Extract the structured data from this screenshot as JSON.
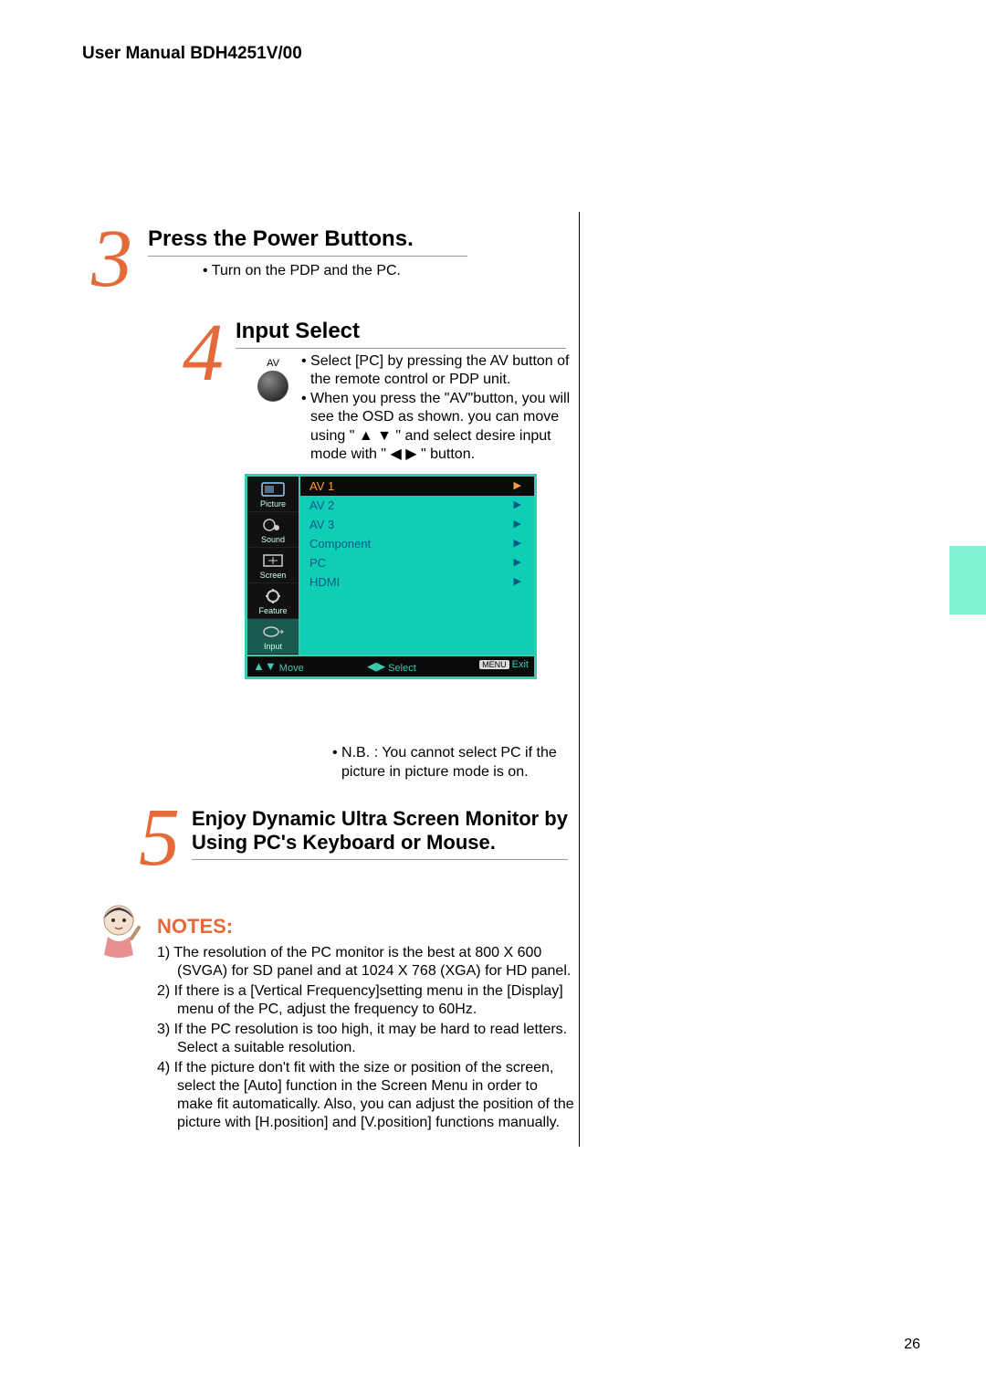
{
  "header": {
    "title": "User Manual BDH4251V/00"
  },
  "step3": {
    "num": "3",
    "title": "Press the Power Buttons.",
    "body": "• Turn on the PDP and the PC."
  },
  "step4": {
    "num": "4",
    "title": "Input Select",
    "av_label": "AV",
    "body_line1": "• Select [PC] by pressing the AV button of the remote control or PDP unit.",
    "body_line2": "• When you press the \"AV\"button, you will see the OSD as shown. you can move using \" ▲ ▼ \" and select desire input  mode with \" ◀ ▶ \" button."
  },
  "osd": {
    "side": [
      {
        "label": "Picture"
      },
      {
        "label": "Sound"
      },
      {
        "label": "Screen"
      },
      {
        "label": "Feature"
      },
      {
        "label": "Input"
      }
    ],
    "items": [
      {
        "label": "AV 1",
        "selected": true
      },
      {
        "label": "AV 2",
        "selected": false
      },
      {
        "label": "AV 3",
        "selected": false
      },
      {
        "label": "Component",
        "selected": false
      },
      {
        "label": "PC",
        "selected": false
      },
      {
        "label": "HDMI",
        "selected": false
      }
    ],
    "footer": {
      "move": "Move",
      "select": "Select",
      "menu": "MENU",
      "exit": "Exit"
    }
  },
  "nb": "• N.B. : You cannot select PC if the picture in picture mode is on.",
  "step5": {
    "num": "5",
    "title": "Enjoy Dynamic Ultra Screen Monitor by Using PC's Keyboard or Mouse."
  },
  "notes": {
    "heading": "NOTES:",
    "items": [
      "1) The resolution of the PC monitor is the best at 800 X 600 (SVGA) for SD panel and at 1024 X 768 (XGA) for HD panel.",
      "2) If there is a [Vertical Frequency]setting menu in the [Display] menu of the PC, adjust the frequency to 60Hz.",
      "3) If the PC resolution is too high, it may be hard to read letters. Select a suitable resolution.",
      "4) If the picture don't fit with the size or position of the screen, select the [Auto] function in the Screen Menu in order to make fit automatically. Also, you can adjust the position of the picture with [H.position] and [V.position] functions manually."
    ]
  },
  "page_number": "26"
}
